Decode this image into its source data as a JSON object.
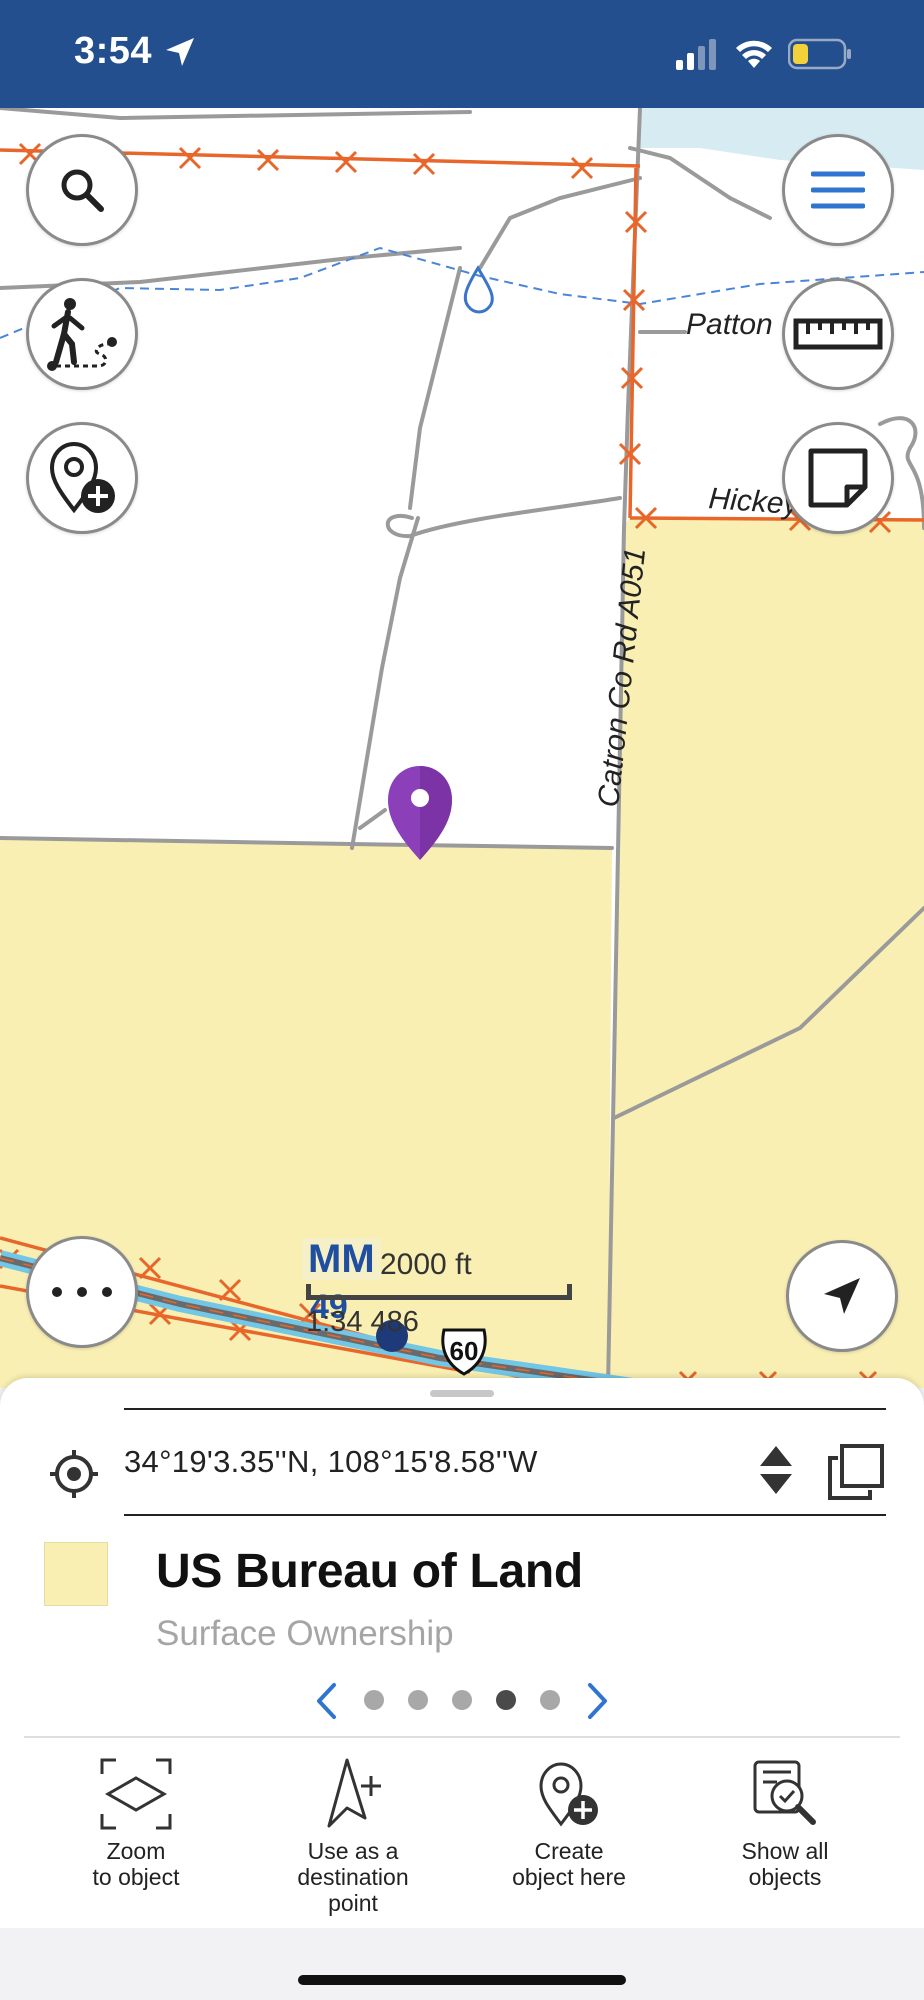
{
  "status_bar": {
    "time": "3:54",
    "background_color": "#234f8e",
    "icons": [
      "location-arrow-icon",
      "signal-icon",
      "wifi-icon",
      "battery-icon"
    ]
  },
  "map": {
    "road_labels": {
      "patton": "Patton",
      "hickey": "Hickey",
      "catron": "Catron Co Rd A051"
    },
    "mm_marker": {
      "label": "MM",
      "number": "49"
    },
    "route_shield": "60",
    "scale": {
      "distance": "2000 ft",
      "ratio": "1:34 486"
    },
    "colors": {
      "land_fill": "#f9efb3",
      "fence_orange": "#e8662a",
      "road_gray": "#9a9a9a",
      "water_blue": "#4a86d8",
      "highway_blue": "#72c6e6",
      "pin_purple": "#8b3fb8"
    },
    "buttons": {
      "left": [
        "search-icon",
        "track-walk-icon",
        "add-place-icon",
        "more-icon"
      ],
      "right": [
        "menu-icon",
        "ruler-icon",
        "note-icon",
        "navigate-arrow-icon"
      ]
    }
  },
  "sheet": {
    "coordinates": "34°19'3.35''N, 108°15'8.58''W",
    "feature_title": "US Bureau of Land",
    "feature_subtitle": "Surface Ownership",
    "pager": {
      "total": 5,
      "active_index": 3
    },
    "swatch_color": "#f9efb3",
    "actions": [
      {
        "label": "Zoom\nto object",
        "icon": "zoom-to-object-icon"
      },
      {
        "label": "Use as a\ndestination\npoint",
        "icon": "destination-point-icon"
      },
      {
        "label": "Create\nobject here",
        "icon": "create-object-icon"
      },
      {
        "label": "Show all\nobjects",
        "icon": "show-all-objects-icon"
      }
    ]
  }
}
